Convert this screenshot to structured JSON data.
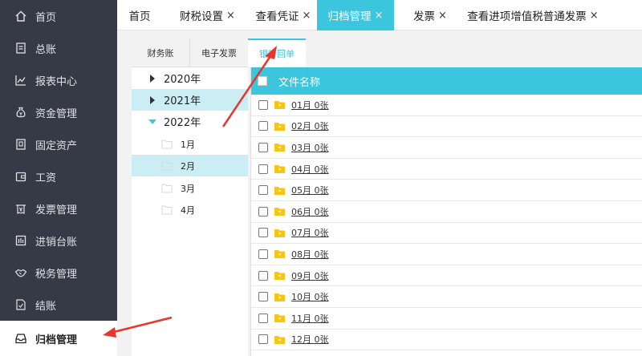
{
  "sidebar": {
    "items": [
      {
        "label": "首页",
        "icon": "home-icon"
      },
      {
        "label": "总账",
        "icon": "ledger-icon"
      },
      {
        "label": "报表中心",
        "icon": "chart-icon"
      },
      {
        "label": "资金管理",
        "icon": "money-bag-icon"
      },
      {
        "label": "固定资产",
        "icon": "asset-icon"
      },
      {
        "label": "工资",
        "icon": "wallet-icon"
      },
      {
        "label": "发票管理",
        "icon": "invoice-icon"
      },
      {
        "label": "进销台账",
        "icon": "inventory-icon"
      },
      {
        "label": "税务管理",
        "icon": "handshake-icon"
      },
      {
        "label": "结账",
        "icon": "checkout-icon"
      },
      {
        "label": "归档管理",
        "icon": "archive-icon"
      }
    ],
    "active_index": 10
  },
  "top_tabs": [
    {
      "label": "首页",
      "closable": false
    },
    {
      "label": "财税设置",
      "closable": true
    },
    {
      "label": "查看凭证",
      "closable": true
    },
    {
      "label": "归档管理",
      "closable": true
    },
    {
      "label": "发票",
      "closable": true
    },
    {
      "label": "查看进项增值税普通发票",
      "closable": true
    }
  ],
  "close_glyph": "×",
  "active_top_tab": 3,
  "tree_tabs": [
    "财务账",
    "电子发票"
  ],
  "tree": {
    "years": [
      {
        "label": "2020年",
        "expanded": false,
        "selected": false
      },
      {
        "label": "2021年",
        "expanded": false,
        "selected": true
      },
      {
        "label": "2022年",
        "expanded": true,
        "selected": false
      }
    ],
    "months": [
      {
        "label": "1月",
        "selected": false
      },
      {
        "label": "2月",
        "selected": true
      },
      {
        "label": "3月",
        "selected": false
      },
      {
        "label": "4月",
        "selected": false
      }
    ]
  },
  "right_tab": "银行回单",
  "grid": {
    "header": "文件名称",
    "files": [
      "01月 0张",
      "02月 0张",
      "03月 0张",
      "04月 0张",
      "05月 0张",
      "06月 0张",
      "07月 0张",
      "08月 0张",
      "09月 0张",
      "10月 0张",
      "11月 0张",
      "12月 0张"
    ]
  },
  "colors": {
    "sidebar_bg": "#363a47",
    "accent": "#3cc6dd",
    "selected_bg": "#cbeef5",
    "arrow": "#e8352f",
    "folder": "#f5c518"
  }
}
